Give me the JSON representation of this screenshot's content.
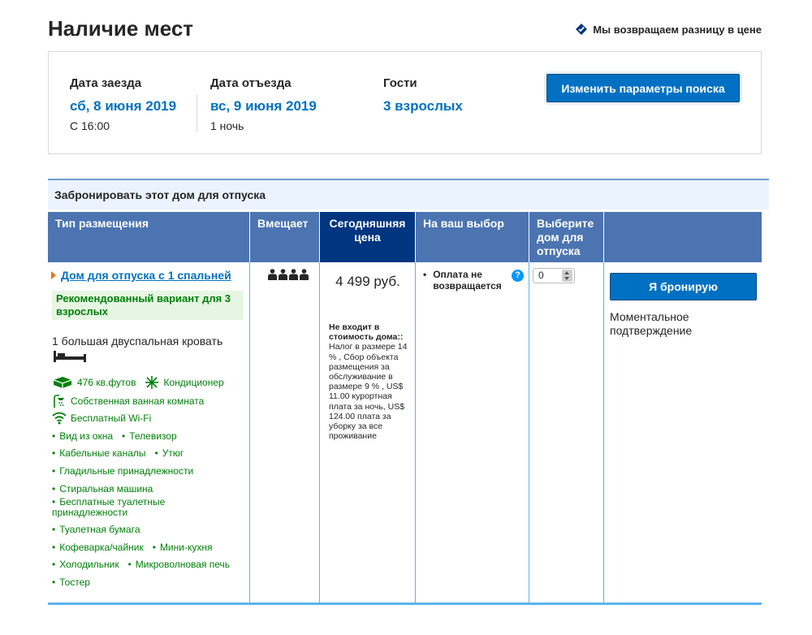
{
  "header": {
    "title": "Наличие мест",
    "price_match": "Мы возвращаем разницу в цене"
  },
  "search": {
    "checkin_label": "Дата заезда",
    "checkin_value": "сб, 8 июня 2019",
    "checkin_sub": "С 16:00",
    "checkout_label": "Дата отъезда",
    "checkout_value": "вс, 9 июня 2019",
    "checkout_sub": "1 ночь",
    "guests_label": "Гости",
    "guests_value": "3 взрослых",
    "change_button": "Изменить параметры поиска"
  },
  "booking": {
    "section_title": "Забронировать этот дом для отпуска",
    "columns": {
      "type": "Тип размещения",
      "capacity": "Вмещает",
      "today_price": "Сегодняшняя цена",
      "choice": "На ваш выбор",
      "select": "Выберите дом для отпуска"
    },
    "room": {
      "name": "Дом для отпуска с 1 спальней",
      "recommended": "Рекомендованный вариант для 3 взрослых",
      "bed": "1 большая двуспальная кровать",
      "capacity_persons": 4,
      "facilities": {
        "area": "476 кв.футов",
        "ac": "Кондиционер",
        "bathroom": "Собственная ванная комната",
        "wifi": "Бесплатный Wi-Fi",
        "view": "Вид из окна",
        "tv": "Телевизор",
        "cable": "Кабельные каналы",
        "iron": "Утюг",
        "ironing": "Гладильные принадлежности",
        "washer": "Стиральная машина",
        "toiletries": "Бесплатные туалетные принадлежности",
        "toilet_paper": "Туалетная бумага",
        "kettle": "Кофеварка/чайник",
        "kitchenette": "Мини-кухня",
        "fridge": "Холодильник",
        "microwave": "Микроволновая печь",
        "toaster": "Тостер"
      },
      "price": "4 499 руб.",
      "tax_bold": "Не входит в стоимость дома::",
      "tax_text": " Налог в размере 14 % , Сбор объекта размещения за обслуживание в размере 9 % , US$ 11.00 курортная плата за ночь, US$ 124.00 плата за уборку за все проживание",
      "choice": "Оплата не возвращается",
      "help": "?",
      "select_value": "0",
      "book_button": "Я бронирую",
      "instant": "Моментальное подтверждение"
    }
  },
  "colors": {
    "primary": "#0071c2",
    "header_bg": "#4b74b1",
    "today_bg": "#003580",
    "green": "#008009",
    "orange": "#e6771e"
  }
}
